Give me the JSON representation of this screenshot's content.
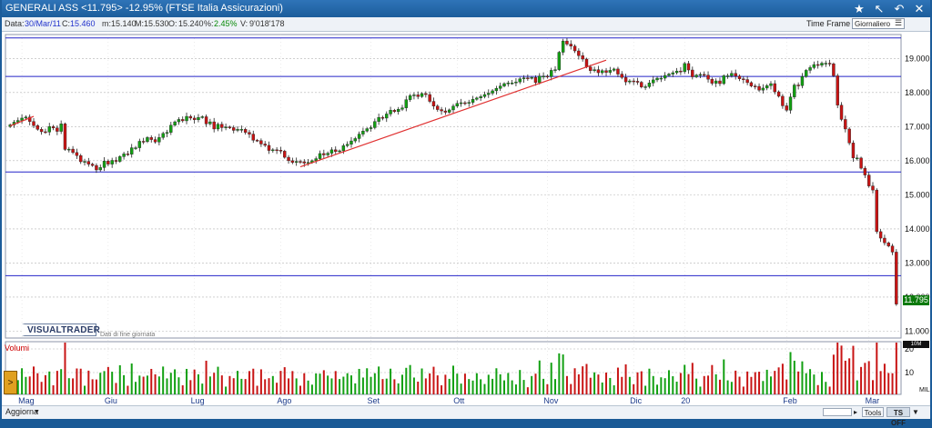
{
  "titlebar": {
    "title": "GENERALI ASS <11.795> -12.95% (FTSE Italia Assicurazioni)",
    "icons": [
      "star-icon",
      "draw-tool-icon",
      "back-icon",
      "close-icon"
    ]
  },
  "infobar": {
    "date_label": "Data:",
    "date_value": "30/Mar/11",
    "close_label": "C:",
    "close_value": "15.460",
    "min_label": "m:",
    "min_value": "15.140",
    "max_label": "M:",
    "max_value": "15.530",
    "open_label": "O:",
    "open_value": "15.240",
    "pct_label": "%:",
    "pct_value": "2.45%",
    "vol_label": "V:",
    "vol_value": "9'018'178",
    "timeframe_label": "Time Frame",
    "timeframe_value": "Giornaliero"
  },
  "colors": {
    "up": "#12a012",
    "down": "#c81414",
    "hline": "#2424c8",
    "trendline": "#e03030",
    "grid": "#b4b4b4"
  },
  "logo": "VISUALTRADER",
  "eod_note": "Dati di fine giornata",
  "volume_label": "Volumi",
  "price_badge": "11.795",
  "volume_badge": "10M",
  "bottombar": {
    "update": "Aggiorna",
    "tools": "Tools",
    "ts_off": "TS OFF"
  },
  "chart_data": [
    {
      "type": "candlestick",
      "ylim": [
        10.8,
        19.7
      ],
      "yticks": [
        "19.000",
        "18.000",
        "17.000",
        "16.000",
        "15.000",
        "14.000",
        "13.000",
        "12.000",
        "11.000"
      ],
      "months": [
        "Mag",
        "Giu",
        "Lug",
        "Ago",
        "Set",
        "Ott",
        "Nov",
        "Dic",
        "20",
        "Feb",
        "Mar"
      ],
      "horizontal_lines": [
        19.6,
        18.47,
        15.67,
        12.63
      ],
      "trendlines": [
        {
          "x": [
            0,
            6
          ],
          "y": [
            17.02,
            17.3
          ]
        },
        {
          "x": [
            74,
            152
          ],
          "y": [
            15.82,
            18.95
          ]
        }
      ],
      "close": [
        17.05,
        17.13,
        17.18,
        17.25,
        17.28,
        17.15,
        17.03,
        16.92,
        16.85,
        16.84,
        17.0,
        16.96,
        16.86,
        17.08,
        16.33,
        16.34,
        16.24,
        16.15,
        15.97,
        15.98,
        15.9,
        15.86,
        15.73,
        15.8,
        15.99,
        15.9,
        16.01,
        15.98,
        16.12,
        16.2,
        16.19,
        16.38,
        16.38,
        16.57,
        16.56,
        16.68,
        16.62,
        16.55,
        16.68,
        16.8,
        16.83,
        17.04,
        17.14,
        17.21,
        17.17,
        17.3,
        17.25,
        17.2,
        17.27,
        17.29,
        17.08,
        17.14,
        16.93,
        17.07,
        16.97,
        16.99,
        16.97,
        16.89,
        16.92,
        16.92,
        16.83,
        16.78,
        16.6,
        16.59,
        16.49,
        16.45,
        16.3,
        16.32,
        16.31,
        16.28,
        16.1,
        16.0,
        15.95,
        15.98,
        15.97,
        15.93,
        15.95,
        16.0,
        16.06,
        16.21,
        16.17,
        16.22,
        16.32,
        16.27,
        16.29,
        16.44,
        16.48,
        16.58,
        16.65,
        16.78,
        16.87,
        16.94,
        16.97,
        17.15,
        17.27,
        17.25,
        17.37,
        17.48,
        17.44,
        17.51,
        17.55,
        17.79,
        17.91,
        17.93,
        17.88,
        17.97,
        17.94,
        17.74,
        17.6,
        17.5,
        17.46,
        17.42,
        17.49,
        17.6,
        17.68,
        17.7,
        17.69,
        17.71,
        17.8,
        17.84,
        17.88,
        17.94,
        17.98,
        18.05,
        18.12,
        18.19,
        18.26,
        18.28,
        18.28,
        18.31,
        18.4,
        18.43,
        18.42,
        18.44,
        18.29,
        18.48,
        18.48,
        18.47,
        18.65,
        18.67,
        19.18,
        19.51,
        19.42,
        19.36,
        19.22,
        19.08,
        18.98,
        18.75,
        18.64,
        18.67,
        18.58,
        18.64,
        18.59,
        18.65,
        18.69,
        18.54,
        18.44,
        18.31,
        18.34,
        18.33,
        18.3,
        18.16,
        18.17,
        18.28,
        18.37,
        18.42,
        18.42,
        18.5,
        18.54,
        18.58,
        18.63,
        18.61,
        18.85,
        18.66,
        18.46,
        18.51,
        18.53,
        18.51,
        18.39,
        18.27,
        18.34,
        18.26,
        18.49,
        18.49,
        18.56,
        18.48,
        18.4,
        18.38,
        18.29,
        18.19,
        18.18,
        18.07,
        18.13,
        18.2,
        18.26,
        18.02,
        17.89,
        17.61,
        17.48,
        17.87,
        18.22,
        18.2,
        18.47,
        18.65,
        18.73,
        18.82,
        18.8,
        18.86,
        18.86,
        18.84,
        18.49,
        17.63,
        17.21,
        16.93,
        16.52,
        16.08,
        16.08,
        15.78,
        15.58,
        15.26,
        15.14,
        13.92,
        13.73,
        13.59,
        13.5,
        13.32,
        11.795
      ],
      "volume_note": "volume histogram, scale 10 and 20 (millions)"
    }
  ]
}
